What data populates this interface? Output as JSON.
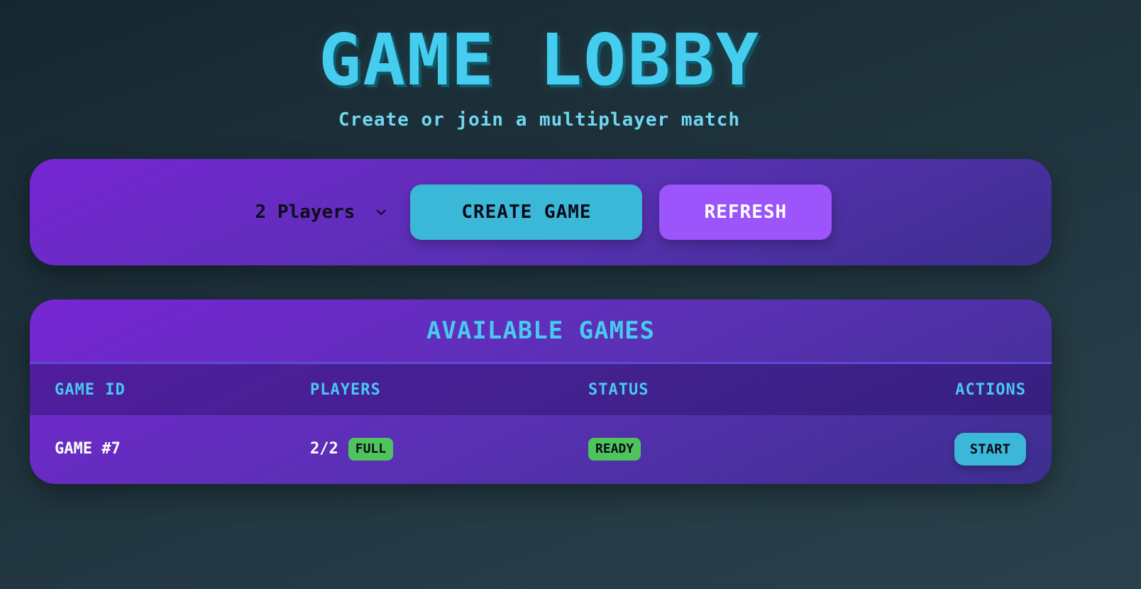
{
  "header": {
    "title": "GAME LOBBY",
    "subtitle": "Create or join a multiplayer match"
  },
  "controls": {
    "player_select": {
      "selected": "2 Players",
      "icon": "chevron-down-icon"
    },
    "create_label": "CREATE GAME",
    "refresh_label": "REFRESH"
  },
  "games": {
    "title": "AVAILABLE GAMES",
    "columns": [
      "GAME ID",
      "PLAYERS",
      "STATUS",
      "ACTIONS"
    ],
    "rows": [
      {
        "id": "GAME #7",
        "players": "2/2",
        "players_badge": "FULL",
        "status": "READY",
        "action": "START"
      }
    ]
  },
  "colors": {
    "accent": "#44cdee",
    "create_button": "#3bb8d8",
    "refresh_button": "#9b55fb",
    "badge_green": "#4ec45c",
    "panel_gradient_start": "#7726d4",
    "panel_gradient_end": "#3c2f8f"
  }
}
